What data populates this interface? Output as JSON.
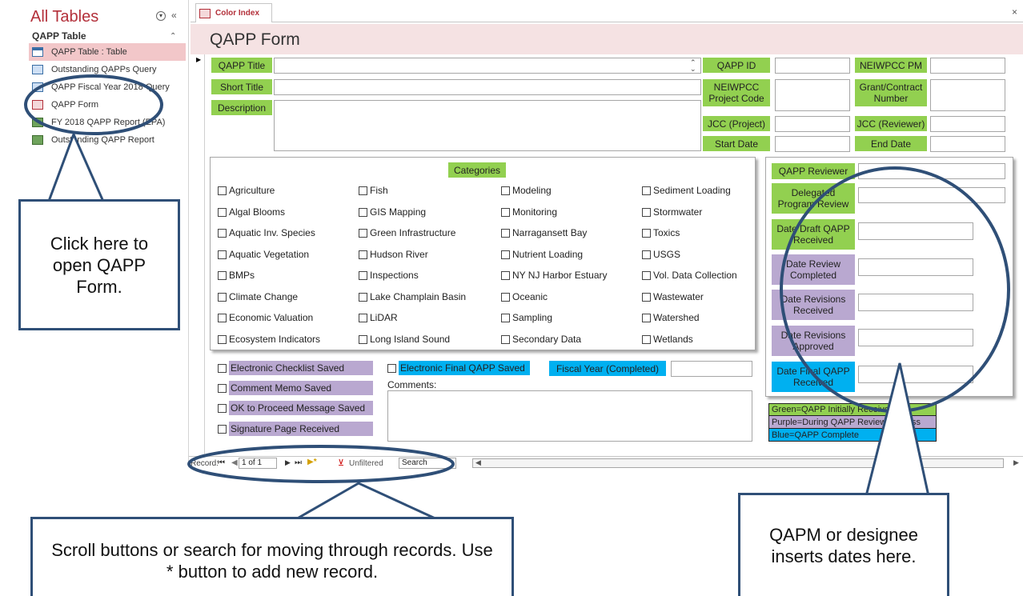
{
  "nav": {
    "title": "All Tables",
    "group": "QAPP Table",
    "items": [
      {
        "label": "QAPP Table : Table",
        "icon": "table-icon"
      },
      {
        "label": "Outstanding QAPPs Query",
        "icon": "query-icon"
      },
      {
        "label": "QAPP Fiscal Year 2018 Query",
        "icon": "query-icon"
      },
      {
        "label": "QAPP Form",
        "icon": "form-icon"
      },
      {
        "label": "FY 2018 QAPP Report (EPA)",
        "icon": "report-icon"
      },
      {
        "label": "Outstanding QAPP Report",
        "icon": "report-icon"
      }
    ]
  },
  "tab": {
    "label": "Color Index"
  },
  "form": {
    "title": "QAPP Form",
    "labels": {
      "qapp_title": "QAPP Title",
      "short_title": "Short Title",
      "description": "Description",
      "qapp_id": "QAPP ID",
      "neiwpcc_pm": "NEIWPCC PM",
      "neiwpcc_project_code": "NEIWPCC Project Code",
      "grant_contract_number": "Grant/Contract Number",
      "jcc_project": "JCC (Project)",
      "jcc_reviewer": "JCC  (Reviewer)",
      "start_date": "Start Date",
      "end_date": "End Date"
    },
    "categories_label": "Categories",
    "categories": [
      [
        "Agriculture",
        "Fish",
        "Modeling",
        "Sediment Loading"
      ],
      [
        "Algal Blooms",
        "GIS Mapping",
        "Monitoring",
        "Stormwater"
      ],
      [
        "Aquatic Inv. Species",
        "Green Infrastructure",
        "Narragansett Bay",
        "Toxics"
      ],
      [
        "Aquatic Vegetation",
        "Hudson River",
        "Nutrient Loading",
        "USGS"
      ],
      [
        "BMPs",
        "Inspections",
        "NY NJ Harbor Estuary",
        "Vol. Data Collection"
      ],
      [
        "Climate Change",
        "Lake Champlain Basin",
        "Oceanic",
        "Wastewater"
      ],
      [
        "Economic Valuation",
        "LiDAR",
        "Sampling",
        "Watershed"
      ],
      [
        "Ecosystem Indicators",
        "Long Island Sound",
        "Secondary Data",
        "Wetlands"
      ]
    ],
    "review": {
      "qapp_reviewer": "QAPP Reviewer",
      "delegated": "Delegated Program Review",
      "date_draft": "Date Draft QAPP Received",
      "date_review": "Date Review Completed",
      "date_rev_received": "Date Revisions Received",
      "date_rev_approved": "Date Revisions Approved",
      "date_final": "Date Final QAPP Received"
    },
    "checks": {
      "checklist": "Electronic Checklist Saved",
      "memo": "Comment Memo Saved",
      "proceed": "OK to Proceed Message Saved",
      "signature": "Signature Page Received",
      "final": "Electronic Final QAPP Saved"
    },
    "fiscal_year": "Fiscal Year (Completed)",
    "comments": "Comments:"
  },
  "legend": [
    {
      "text": "Green=QAPP Initially Received",
      "color": "#92d050"
    },
    {
      "text": "Purple=During QAPP Review Process",
      "color": "#b9a8d0"
    },
    {
      "text": "Blue=QAPP Complete",
      "color": "#00b0f0"
    }
  ],
  "recnav": {
    "record_label": "Record:",
    "current": "1 of 1",
    "filter": "Unfiltered",
    "search": "Search"
  },
  "callouts": {
    "open_form": "Click here to open QAPP Form.",
    "scroll": "Scroll buttons or search for moving through records. Use * button to add new record.",
    "dates": "QAPM or designee inserts dates here."
  },
  "colors": {
    "outline": "#2f4f77",
    "accent": "#b3303a"
  }
}
